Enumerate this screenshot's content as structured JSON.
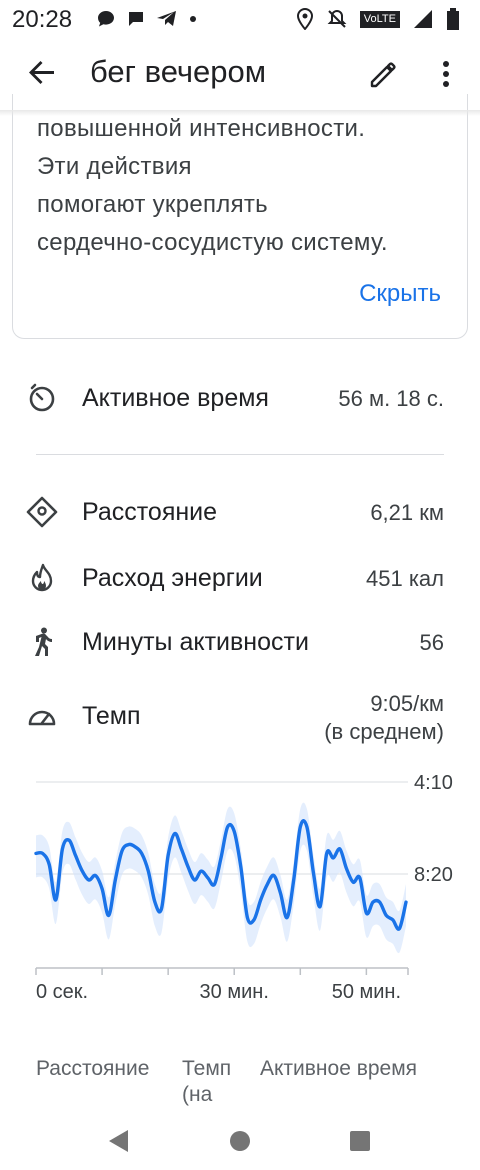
{
  "status_bar": {
    "time": "20:28",
    "icons_left": [
      "chat-bubble-icon",
      "message-icon",
      "telegram-icon",
      "dot-icon"
    ],
    "icons_right": [
      "location-icon",
      "bell-off-icon",
      "volte-icon",
      "signal-icon",
      "battery-icon"
    ],
    "volte_label": "VoLTE"
  },
  "app_bar": {
    "title": "бег вечером",
    "back_icon": "arrow-back-icon",
    "edit_icon": "pencil-icon",
    "more_icon": "more-vert-icon"
  },
  "info_card": {
    "lines": [
      "повышенной интенсивности.",
      "Эти действия",
      "помогают укреплять",
      "сердечно-сосудистую систему."
    ],
    "hide_label": "Скрыть",
    "accent_color": "#1a73e8"
  },
  "metrics": {
    "active_time": {
      "label": "Активное время",
      "value": "56 м. 18 с.",
      "icon": "timer-icon"
    },
    "distance": {
      "label": "Расстояние",
      "value": "6,21 км",
      "icon": "location-diamond-icon"
    },
    "energy": {
      "label": "Расход энергии",
      "value": "451 кал",
      "icon": "flame-icon"
    },
    "active_minutes": {
      "label": "Минуты активности",
      "value": "56",
      "icon": "walking-person-icon"
    },
    "pace": {
      "label": "Темп",
      "value_line1": "9:05/км",
      "value_line2": "(в среднем)",
      "icon": "speedometer-icon"
    }
  },
  "chart_data": {
    "type": "line",
    "x_label_ticks": [
      "0 сек.",
      "30 мин.",
      "50 мин."
    ],
    "y_tick_labels": [
      "4:10",
      "8:20"
    ],
    "series_color": "#1a73e8",
    "band_color": "#d2e3fc",
    "x_range_minutes": [
      0,
      56.3
    ],
    "y_range_min_per_km": [
      4.17,
      12.5
    ],
    "y_inverted": true,
    "grid": true,
    "series": [
      {
        "x": [
          0,
          1,
          2,
          3,
          4,
          5,
          6,
          7,
          8,
          9,
          10,
          11,
          12,
          13,
          14,
          15,
          16,
          17,
          18,
          19,
          20,
          21,
          22,
          23,
          24,
          25,
          26,
          27,
          28,
          29,
          30,
          31,
          32,
          33,
          34,
          35,
          36,
          37,
          38,
          39,
          40,
          41,
          42,
          43,
          44,
          45,
          46,
          47,
          48,
          49,
          50,
          51,
          52,
          53,
          54,
          55,
          56
        ],
        "y": [
          7.4,
          7.4,
          7.9,
          9.5,
          7.2,
          6.8,
          7.5,
          8.2,
          8.6,
          8.4,
          9.0,
          10.2,
          8.6,
          7.3,
          7.0,
          7.1,
          7.4,
          8.2,
          9.6,
          9.9,
          7.5,
          6.5,
          7.2,
          8.0,
          8.6,
          8.2,
          8.5,
          8.8,
          7.6,
          6.2,
          6.4,
          8.0,
          10.3,
          10.4,
          9.5,
          8.8,
          8.4,
          9.2,
          10.3,
          8.6,
          6.2,
          6.2,
          8.3,
          9.8,
          7.4,
          7.6,
          7.2,
          8.1,
          8.7,
          8.5,
          10.1,
          9.6,
          9.6,
          10.2,
          10.4,
          10.8,
          9.6
        ]
      }
    ]
  },
  "tabs": [
    {
      "label": "Расстояние"
    },
    {
      "label": "Темп (на"
    },
    {
      "label": "Активное время"
    }
  ],
  "nav_bar": {
    "back": "nav-back-icon",
    "home": "nav-home-icon",
    "recents": "nav-recents-icon"
  }
}
